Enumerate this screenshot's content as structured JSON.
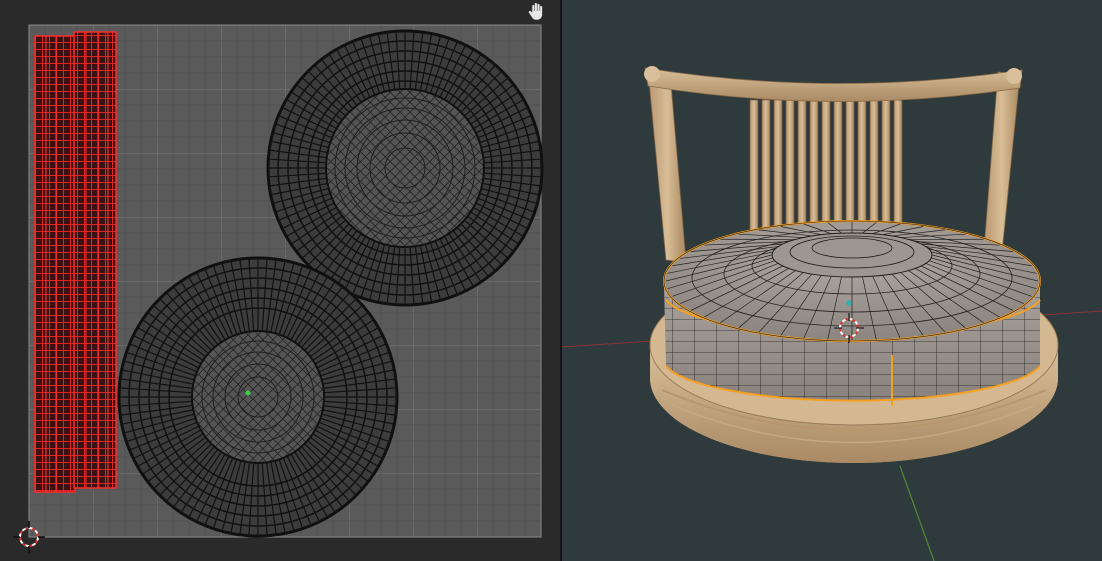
{
  "uv_editor": {
    "icons": {
      "pan": "hand-icon",
      "cursor": "2d-cursor-icon"
    },
    "colors": {
      "background": "#2a2a2a",
      "grid": "#8a8a8a",
      "selected_uvs": "#d21e1e",
      "wire": "#0e0e0e"
    }
  },
  "viewport": {
    "icons": {
      "cursor": "3d-cursor-icon",
      "origin": "object-origin-icon"
    },
    "colors": {
      "background": "#2f3a3d",
      "x_axis": "#9b3a3a",
      "y_axis": "#5a8a3a",
      "wood": "#cdb08a",
      "cushion": "#9c9490",
      "selection": "#f5a020"
    }
  }
}
